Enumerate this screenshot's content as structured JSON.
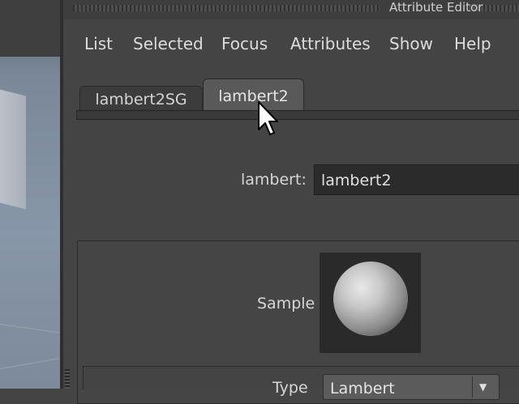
{
  "window": {
    "title": "Attribute Editor"
  },
  "menubar": {
    "items": [
      "List",
      "Selected",
      "Focus",
      "Attributes",
      "Show",
      "Help"
    ]
  },
  "tabs": [
    {
      "label": "lambert2SG",
      "active": false
    },
    {
      "label": "lambert2",
      "active": true
    }
  ],
  "material": {
    "type_label": "lambert:",
    "name_value": "lambert2"
  },
  "sample": {
    "label": "Sample"
  },
  "type_field": {
    "label": "Type",
    "selected": "Lambert"
  },
  "icons": {
    "sample_sphere": "sphere-preview-icon",
    "dropdown": "chevron-down-icon",
    "cursor": "mouse-pointer-icon"
  }
}
